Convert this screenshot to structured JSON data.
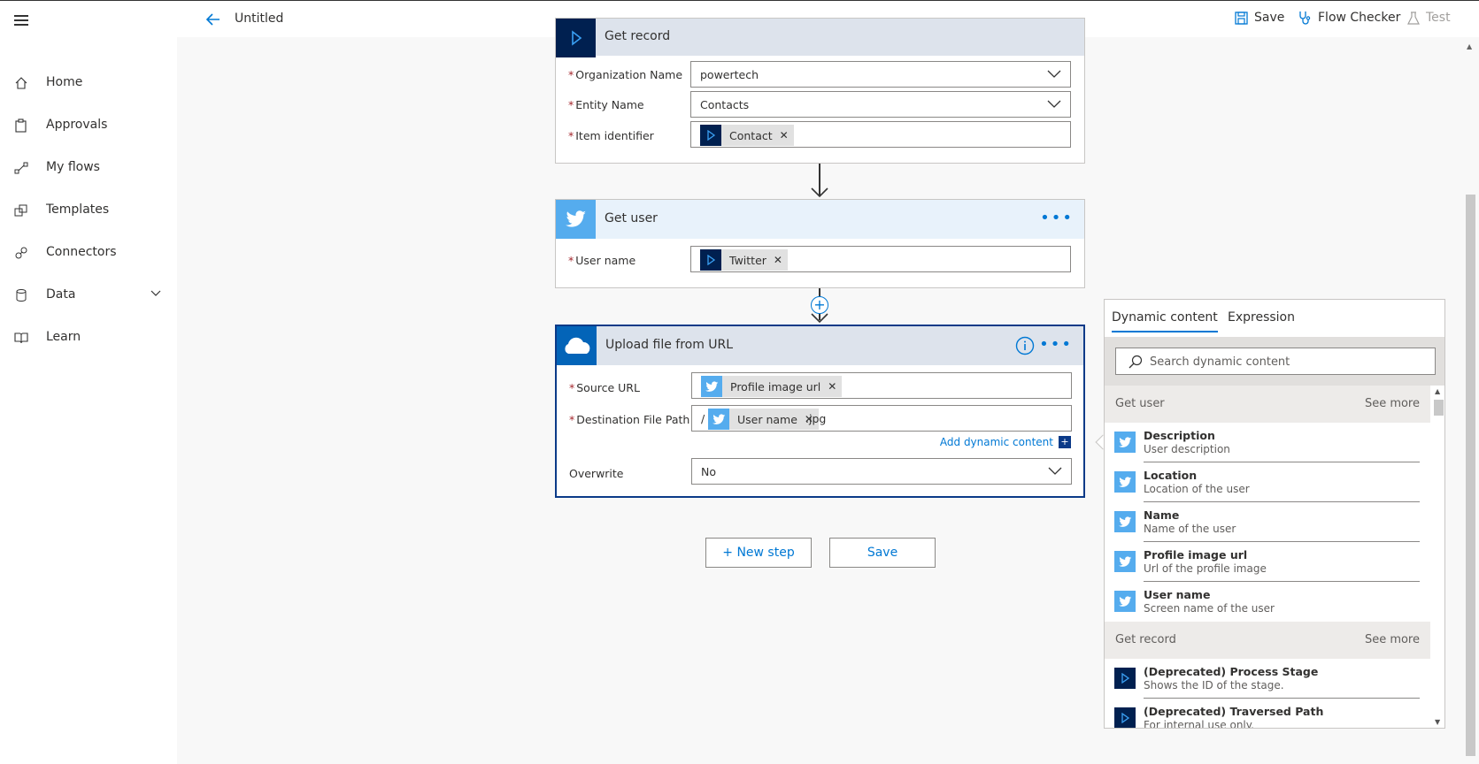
{
  "header": {
    "title": "Untitled",
    "save_label": "Save",
    "flow_checker_label": "Flow Checker",
    "test_label": "Test"
  },
  "sidebar": {
    "items": [
      {
        "label": "Home",
        "icon": "home-icon"
      },
      {
        "label": "Approvals",
        "icon": "clipboard-icon"
      },
      {
        "label": "My flows",
        "icon": "flow-icon"
      },
      {
        "label": "Templates",
        "icon": "templates-icon"
      },
      {
        "label": "Connectors",
        "icon": "connector-icon"
      },
      {
        "label": "Data",
        "icon": "database-icon",
        "expandable": true
      },
      {
        "label": "Learn",
        "icon": "book-icon"
      }
    ]
  },
  "get_record": {
    "title": "Get record",
    "fields": [
      {
        "label": "Organization Name",
        "value": "powertech"
      },
      {
        "label": "Entity Name",
        "value": "Contacts"
      },
      {
        "label": "Item identifier",
        "token": "Contact"
      }
    ]
  },
  "get_user": {
    "title": "Get user",
    "field_label": "User name",
    "token": "Twitter"
  },
  "upload": {
    "title": "Upload file from URL",
    "source_label": "Source URL",
    "source_token": "Profile image url",
    "dest_label": "Destination File Path",
    "dest_prefix": "/",
    "dest_token": "User name",
    "dest_suffix": ".jpg",
    "add_dynamic": "Add dynamic content",
    "overwrite_label": "Overwrite",
    "overwrite_value": "No"
  },
  "actions": {
    "new_step": "+ New step",
    "save": "Save"
  },
  "dynamic_panel": {
    "tabs": [
      "Dynamic content",
      "Expression"
    ],
    "search_placeholder": "Search dynamic content",
    "sections": [
      {
        "name": "Get user",
        "see_more": "See more",
        "items": [
          {
            "title": "Description",
            "subtitle": "User description"
          },
          {
            "title": "Location",
            "subtitle": "Location of the user"
          },
          {
            "title": "Name",
            "subtitle": "Name of the user"
          },
          {
            "title": "Profile image url",
            "subtitle": "Url of the profile image"
          },
          {
            "title": "User name",
            "subtitle": "Screen name of the user"
          }
        ]
      },
      {
        "name": "Get record",
        "see_more": "See more",
        "items": [
          {
            "title": "(Deprecated) Process Stage",
            "subtitle": "Shows the ID of the stage."
          },
          {
            "title": "(Deprecated) Traversed Path",
            "subtitle": "For internal use only."
          }
        ]
      }
    ]
  },
  "colors": {
    "accent": "#0078d4",
    "twitter": "#55acee",
    "dynamics": "#002050",
    "onedrive": "#0364b8",
    "required": "#a4262c"
  }
}
